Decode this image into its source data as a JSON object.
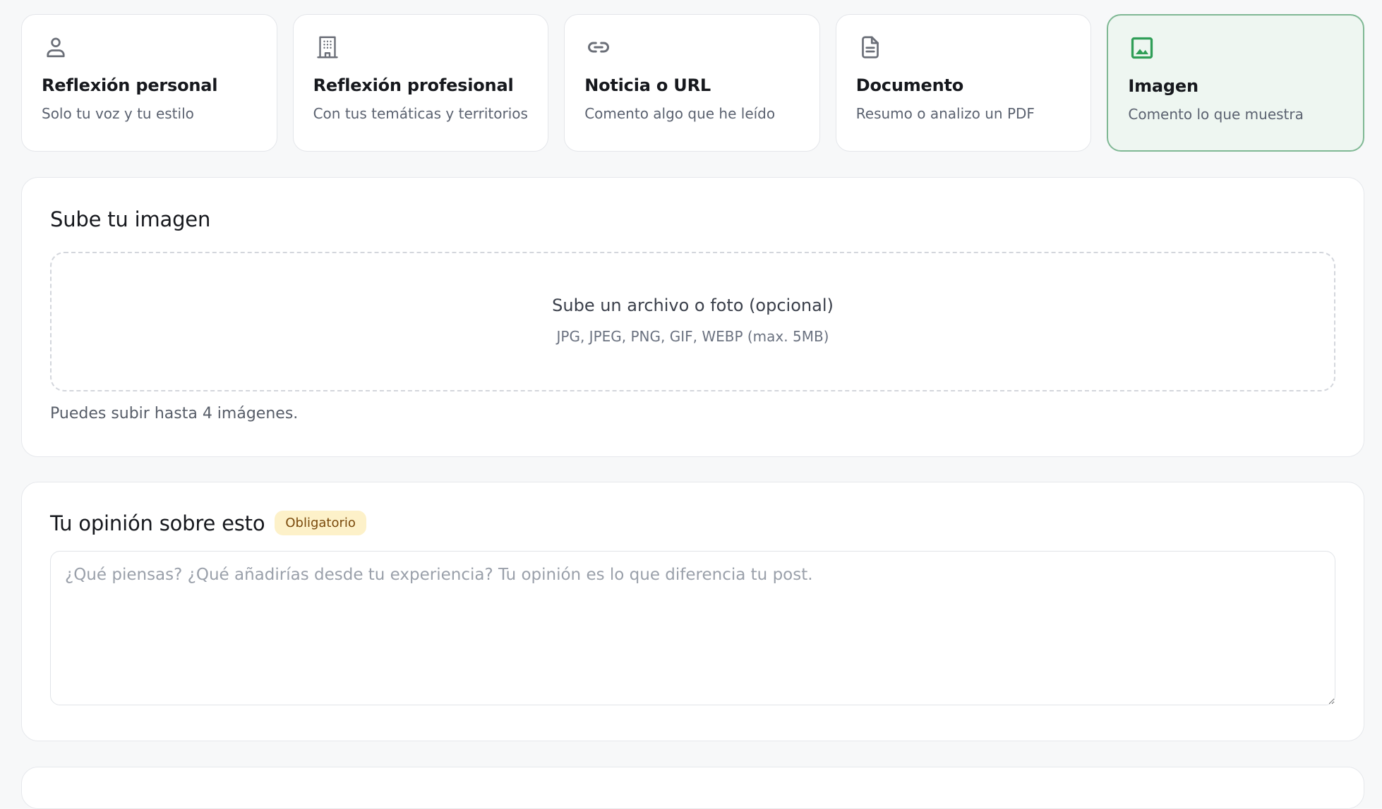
{
  "post_types": [
    {
      "title": "Reflexión personal",
      "desc": "Solo tu voz y tu estilo",
      "icon": "person-icon",
      "active": false
    },
    {
      "title": "Reflexión profesional",
      "desc": "Con tus temáticas y territorios",
      "icon": "building-icon",
      "active": false
    },
    {
      "title": "Noticia o URL",
      "desc": "Comento algo que he leído",
      "icon": "link-icon",
      "active": false
    },
    {
      "title": "Documento",
      "desc": "Resumo o analizo un PDF",
      "icon": "document-icon",
      "active": false
    },
    {
      "title": "Imagen",
      "desc": "Comento lo que muestra",
      "icon": "image-icon",
      "active": true
    }
  ],
  "upload": {
    "heading": "Sube tu imagen",
    "dropzone_title": "Sube un archivo o foto (opcional)",
    "dropzone_hint": "JPG, JPEG, PNG, GIF, WEBP (max. 5MB)",
    "note": "Puedes subir hasta 4 imágenes."
  },
  "opinion": {
    "heading": "Tu opinión sobre esto",
    "badge": "Obligatorio",
    "placeholder": "¿Qué piensas? ¿Qué añadirías desde tu experiencia? Tu opinión es lo que diferencia tu post.",
    "value": ""
  },
  "colors": {
    "accent": "#2f9e57",
    "active_bg": "#eef6f1",
    "active_border": "#7fb894",
    "icon_gray": "#6b6f78",
    "badge_bg": "#fdf1c9",
    "badge_text": "#7a4a0c"
  }
}
